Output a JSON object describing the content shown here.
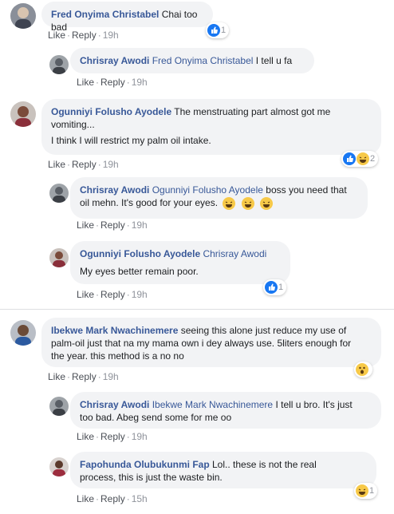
{
  "comments": [
    {
      "name": "Fred Onyima Christabel",
      "text": "Chai too bad",
      "like": "Like",
      "reply": "Reply",
      "time": "19h",
      "reactions": "1"
    },
    {
      "name": "Chrisray Awodi",
      "tag": "Fred Onyima Christabel",
      "text": "I tell u fa",
      "like": "Like",
      "reply": "Reply",
      "time": "19h"
    },
    {
      "name": "Ogunniyi Folusho Ayodele",
      "text1": "The menstruating part almost got me",
      "text2": "vomiting...",
      "text3": "I think I will restrict my palm oil intake.",
      "like": "Like",
      "reply": "Reply",
      "time": "19h",
      "reactions": "2"
    },
    {
      "name": "Chrisray Awodi",
      "tag": "Ogunniyi Folusho Ayodele",
      "text1": "boss you need that",
      "text2": "oil mehn. It's good for your eyes.",
      "like": "Like",
      "reply": "Reply",
      "time": "19h"
    },
    {
      "name": "Ogunniyi Folusho Ayodele",
      "tag": "Chrisray Awodi",
      "text": "My eyes better remain poor.",
      "like": "Like",
      "reply": "Reply",
      "time": "19h",
      "reactions": "1"
    },
    {
      "name": "Ibekwe Mark Nwachinemere",
      "text1": "seeing this alone just reduce my use of",
      "text2": "palm-oil just that na my mama own i dey always use. 5liters enough for",
      "text3": "the year. this method is a no no",
      "like": "Like",
      "reply": "Reply",
      "time": "19h"
    },
    {
      "name": "Chrisray Awodi",
      "tag": "Ibekwe Mark Nwachinemere",
      "text1": "I tell u bro. It's just",
      "text2": "too bad. Abeg send some for me oo",
      "like": "Like",
      "reply": "Reply",
      "time": "19h"
    },
    {
      "name": "Fapohunda Olubukunmi Fap",
      "text1": "Lol.. these is not the real",
      "text2": "process, this is just the waste bin.",
      "like": "Like",
      "reply": "Reply",
      "time": "15h",
      "reactions": "1"
    }
  ],
  "sep": "·",
  "icons": {
    "like": "like-reaction-icon",
    "haha": "haha-reaction-icon",
    "wow": "wow-reaction-icon"
  }
}
